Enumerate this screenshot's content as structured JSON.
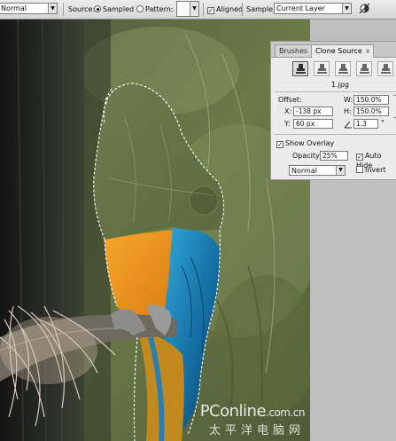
{
  "options_bar": {
    "mode_value": "Normal",
    "source_label": "Source:",
    "source_options": [
      {
        "label": "Sampled",
        "selected": true
      },
      {
        "label": "Pattern:",
        "selected": false
      }
    ],
    "aligned_label": "Aligned",
    "aligned_checked": true,
    "sample_label": "Sample:",
    "sample_value": "Current Layer",
    "ignore_adjustment_icon": "ignore-adjustment-layers-icon"
  },
  "clone_source_panel": {
    "tabs": [
      {
        "label": "Brushes",
        "active": false
      },
      {
        "label": "Clone Source",
        "active": true
      }
    ],
    "close_glyph": "x",
    "source_buttons": 5,
    "source_file": "1.jpg",
    "offset_label": "Offset:",
    "x_label": "X:",
    "x_value": "-138 px",
    "y_label": "Y:",
    "y_value": "60 px",
    "w_label": "W:",
    "w_value": "150.0%",
    "h_label": "H:",
    "h_value": "150.0%",
    "angle_value": "1.3",
    "degree_symbol": "°",
    "show_overlay_label": "Show Overlay",
    "show_overlay_checked": true,
    "opacity_label": "Opacity:",
    "opacity_value": "25%",
    "auto_hide_label": "Auto Hide",
    "auto_hide_checked": true,
    "blend_value": "Normal",
    "invert_label": "Invert",
    "invert_checked": false
  },
  "watermark": {
    "line1_big": "PConline",
    "line1_small": ".com.cn",
    "line2": "太平洋电脑网"
  },
  "colors": {
    "toolbar_bg": "#e2e2e2",
    "panel_bg": "#ececec",
    "parrot_orange": "#e8901c",
    "parrot_blue": "#1f7fb2",
    "foliage_green": "#7a8a55"
  }
}
